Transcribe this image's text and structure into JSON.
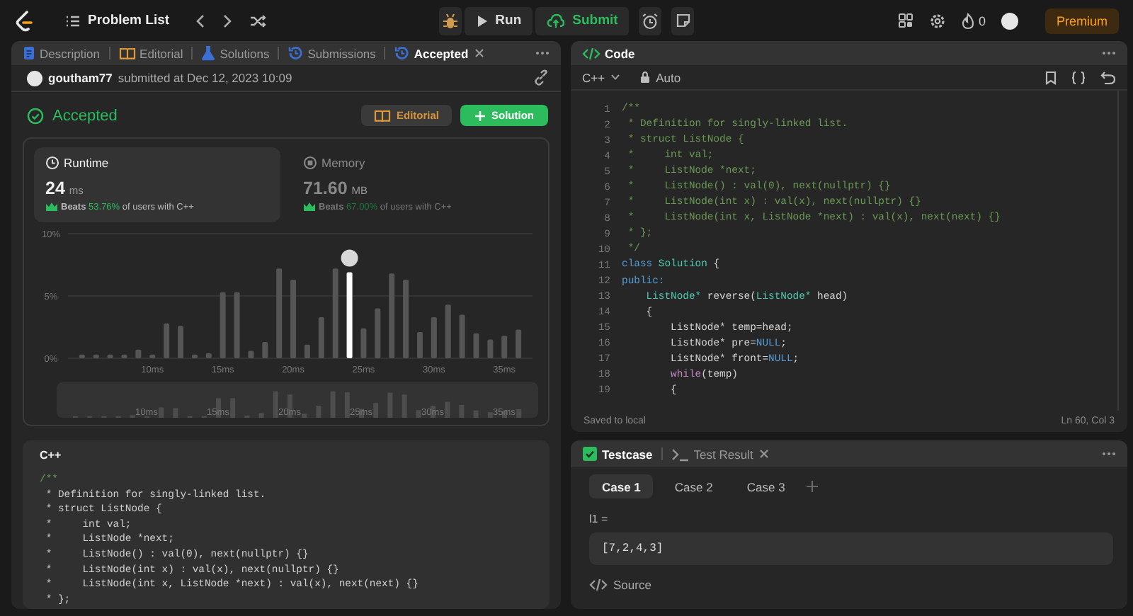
{
  "topbar": {
    "title": "Problem List",
    "run": "Run",
    "submit": "Submit",
    "streak": "0",
    "premium": "Premium"
  },
  "left_panel": {
    "tabs": [
      {
        "label": "Description",
        "kind": "description",
        "selected": false,
        "closable": false
      },
      {
        "label": "Editorial",
        "kind": "editorial",
        "selected": false,
        "closable": false
      },
      {
        "label": "Solutions",
        "kind": "solutions",
        "selected": false,
        "closable": false
      },
      {
        "label": "Submissions",
        "kind": "submissions",
        "selected": false,
        "closable": false
      },
      {
        "label": "Accepted",
        "kind": "submissions",
        "selected": true,
        "closable": true
      }
    ],
    "submission": {
      "user": "goutham77",
      "submitted": "submitted at Dec 12, 2023 10:09"
    },
    "status": "Accepted",
    "buttons": [
      {
        "label": "Editorial",
        "kind": "editorial"
      },
      {
        "label": "Solution",
        "kind": "solution"
      }
    ],
    "stats": [
      {
        "kind": "runtime",
        "label": "Runtime",
        "value": "24",
        "unit": "ms",
        "beats": "Beats",
        "percent": "53.76%",
        "suffix": "of users with C++",
        "selected": true
      },
      {
        "kind": "memory",
        "label": "Memory",
        "value": "71.60",
        "unit": "MB",
        "beats": "Beats",
        "percent": "67.00%",
        "suffix": "of users with C++",
        "selected": false
      }
    ],
    "chart_data": {
      "type": "bar",
      "x": [
        5,
        6,
        7,
        8,
        9,
        10,
        11,
        12,
        13,
        14,
        15,
        16,
        17,
        18,
        19,
        20,
        21,
        22,
        23,
        24,
        25,
        26,
        27,
        28,
        29,
        30,
        31,
        32,
        33,
        34,
        35,
        36
      ],
      "series": [
        {
          "color": "#555555",
          "values": [
            0.3,
            0.3,
            0.3,
            0.3,
            0.7,
            0.3,
            2.8,
            2.6,
            0.3,
            0.4,
            5.3,
            5.3,
            0.6,
            1.3,
            7.2,
            6.3,
            1.1,
            3.3,
            7.2,
            null,
            2.4,
            4.0,
            6.8,
            6.3,
            2.1,
            3.3,
            4.3,
            3.5,
            2.0,
            1.5,
            1.8,
            2.3
          ]
        },
        {
          "color": "#ffffff",
          "marker": true,
          "values": [
            null,
            null,
            null,
            null,
            null,
            null,
            null,
            null,
            null,
            null,
            null,
            null,
            null,
            null,
            null,
            null,
            null,
            null,
            null,
            6.9,
            null,
            null,
            null,
            null,
            null,
            null,
            null,
            null,
            null,
            null,
            null,
            null
          ]
        }
      ],
      "stacked": true,
      "xlim": [
        4,
        37
      ],
      "ylim": [
        0,
        10
      ],
      "yticks": [
        {
          "value": 0,
          "label": "0%"
        },
        {
          "value": 5,
          "label": "5%"
        },
        {
          "value": 10,
          "label": "10%"
        }
      ],
      "xticks": [
        {
          "value": 10,
          "label": "10ms"
        },
        {
          "value": 15,
          "label": "15ms"
        },
        {
          "value": 20,
          "label": "20ms"
        },
        {
          "value": 25,
          "label": "25ms"
        },
        {
          "value": 30,
          "label": "30ms"
        },
        {
          "value": 35,
          "label": "35ms"
        }
      ]
    },
    "overview": {
      "labels": [
        "10ms",
        "15ms",
        "20ms",
        "25ms",
        "30ms",
        "35ms"
      ]
    },
    "code_card": {
      "language": "C++",
      "lines": [
        [
          {
            "kind": "comment",
            "text": "/**"
          }
        ],
        [
          {
            "kind": "plain",
            "text": " * Definition for singly-linked list."
          }
        ],
        [
          {
            "kind": "plain",
            "text": " * struct ListNode {"
          }
        ],
        [
          {
            "kind": "plain",
            "text": " *     int val;"
          }
        ],
        [
          {
            "kind": "plain",
            "text": " *     ListNode *next;"
          }
        ],
        [
          {
            "kind": "plain",
            "text": " *     ListNode() : val(0), next(nullptr) {}"
          }
        ],
        [
          {
            "kind": "plain",
            "text": " *     ListNode(int x) : val(x), next(nullptr) {}"
          }
        ],
        [
          {
            "kind": "plain",
            "text": " *     ListNode(int x, ListNode *next) : val(x), next(next) {}"
          }
        ],
        [
          {
            "kind": "plain",
            "text": " * };"
          }
        ]
      ]
    }
  },
  "editor": {
    "title": "Code",
    "language": "C++",
    "mode": "Auto",
    "status": "Saved to local",
    "cursor": "Ln 60, Col 3",
    "lines": [
      {
        "no": "1",
        "tokens": [
          {
            "kind": "comment",
            "text": "/**"
          }
        ]
      },
      {
        "no": "2",
        "tokens": [
          {
            "kind": "comment",
            "text": " * Definition for singly-linked list."
          }
        ]
      },
      {
        "no": "3",
        "tokens": [
          {
            "kind": "comment",
            "text": " * struct ListNode {"
          }
        ]
      },
      {
        "no": "4",
        "tokens": [
          {
            "kind": "comment",
            "text": " *     int val;"
          }
        ]
      },
      {
        "no": "5",
        "tokens": [
          {
            "kind": "comment",
            "text": " *     ListNode *next;"
          }
        ]
      },
      {
        "no": "6",
        "tokens": [
          {
            "kind": "comment",
            "text": " *     ListNode() : val(0), next(nullptr) {}"
          }
        ]
      },
      {
        "no": "7",
        "tokens": [
          {
            "kind": "comment",
            "text": " *     ListNode(int x) : val(x), next(nullptr) {}"
          }
        ]
      },
      {
        "no": "8",
        "tokens": [
          {
            "kind": "comment",
            "text": " *     ListNode(int x, ListNode *next) : val(x), next(next) {}"
          }
        ]
      },
      {
        "no": "9",
        "tokens": [
          {
            "kind": "comment",
            "text": " * };"
          }
        ]
      },
      {
        "no": "10",
        "tokens": [
          {
            "kind": "comment",
            "text": " */"
          }
        ]
      },
      {
        "no": "11",
        "tokens": [
          {
            "kind": "keyword",
            "text": "class"
          },
          {
            "kind": "type",
            "text": " Solution"
          },
          {
            "kind": "plain",
            "text": " {"
          }
        ]
      },
      {
        "no": "12",
        "tokens": [
          {
            "kind": "keyword",
            "text": "public:"
          }
        ]
      },
      {
        "no": "13",
        "tokens": [
          {
            "kind": "type",
            "text": "    ListNode*"
          },
          {
            "kind": "plain",
            "text": " reverse("
          },
          {
            "kind": "type",
            "text": "ListNode*"
          },
          {
            "kind": "plain",
            "text": " head)"
          }
        ]
      },
      {
        "no": "14",
        "tokens": [
          {
            "kind": "plain",
            "text": "    {"
          }
        ]
      },
      {
        "no": "15",
        "tokens": [
          {
            "kind": "plain",
            "text": "        ListNode* temp=head;"
          }
        ]
      },
      {
        "no": "16",
        "tokens": [
          {
            "kind": "plain",
            "text": "        ListNode* pre="
          },
          {
            "kind": "constant",
            "text": "NULL"
          },
          {
            "kind": "plain",
            "text": ";"
          }
        ]
      },
      {
        "no": "17",
        "tokens": [
          {
            "kind": "plain",
            "text": "        ListNode* front="
          },
          {
            "kind": "constant",
            "text": "NULL"
          },
          {
            "kind": "plain",
            "text": ";"
          }
        ]
      },
      {
        "no": "18",
        "tokens": [
          {
            "kind": "control",
            "text": "        while"
          },
          {
            "kind": "plain",
            "text": "(temp)"
          }
        ]
      },
      {
        "no": "19",
        "tokens": [
          {
            "kind": "plain",
            "text": "        {"
          }
        ]
      }
    ]
  },
  "testcase": {
    "tabs": [
      {
        "label": "Testcase",
        "kind": "testcase",
        "selected": true,
        "closable": false
      },
      {
        "label": "Test Result",
        "kind": "result",
        "selected": false,
        "closable": true
      }
    ],
    "cases": [
      {
        "label": "Case 1",
        "selected": true
      },
      {
        "label": "Case 2",
        "selected": false
      },
      {
        "label": "Case 3",
        "selected": false
      }
    ],
    "param": "l1 =",
    "value": "[7,2,4,3]",
    "source": "Source"
  }
}
